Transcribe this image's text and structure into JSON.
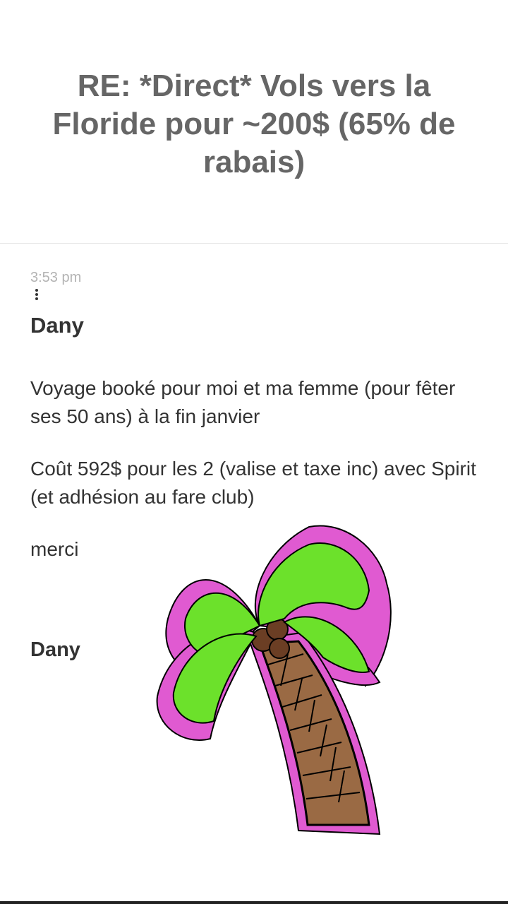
{
  "email": {
    "subject": "RE: *Direct* Vols vers la Floride pour ~200$ (65% de rabais)",
    "time": "3:53 pm",
    "sender": "Dany",
    "paragraphs": [
      "Voyage booké pour moi et ma femme (pour fêter ses 50 ans) à la fin janvier",
      "Coût 592$ pour les 2 (valise et taxe inc) avec Spirit (et adhésion au fare club)",
      "merci"
    ],
    "signature": "Dany",
    "image": {
      "icon": "palm-tree-icon",
      "outline_color": "#e05ad1",
      "leaf_color": "#6ce12b",
      "trunk_color": "#9a6a44"
    }
  },
  "menu": {
    "icon": "more-vertical-icon"
  }
}
